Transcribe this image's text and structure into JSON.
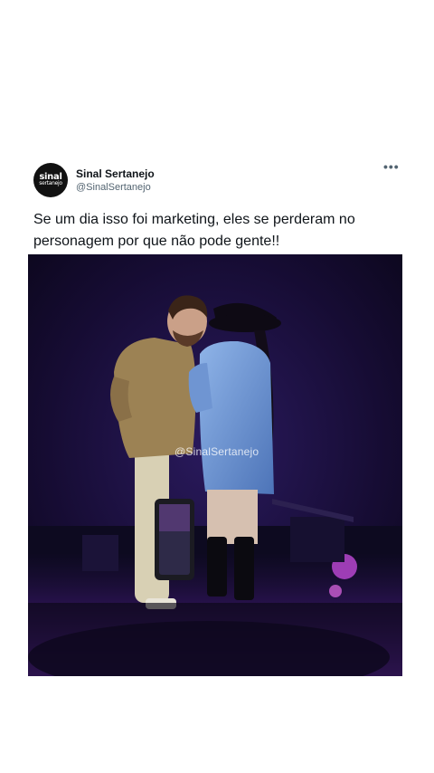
{
  "tweet": {
    "display_name": "Sinal Sertanejo",
    "handle": "@SinalSertanejo",
    "avatar_logo_top": "sinal",
    "avatar_logo_bottom": "sertanejo",
    "text": "Se um dia isso foi marketing, eles se perderam no personagem por que não pode gente!!",
    "more_icon": "ellipsis-icon",
    "media": {
      "kind": "photo",
      "watermark": "@SinalSertanejo"
    }
  },
  "colors": {
    "background": "#ffffff",
    "text_primary": "#0f1419",
    "text_secondary": "#536471",
    "stage_dark": "#1a0f3a",
    "stage_light_purple": "#7a2fd0"
  }
}
